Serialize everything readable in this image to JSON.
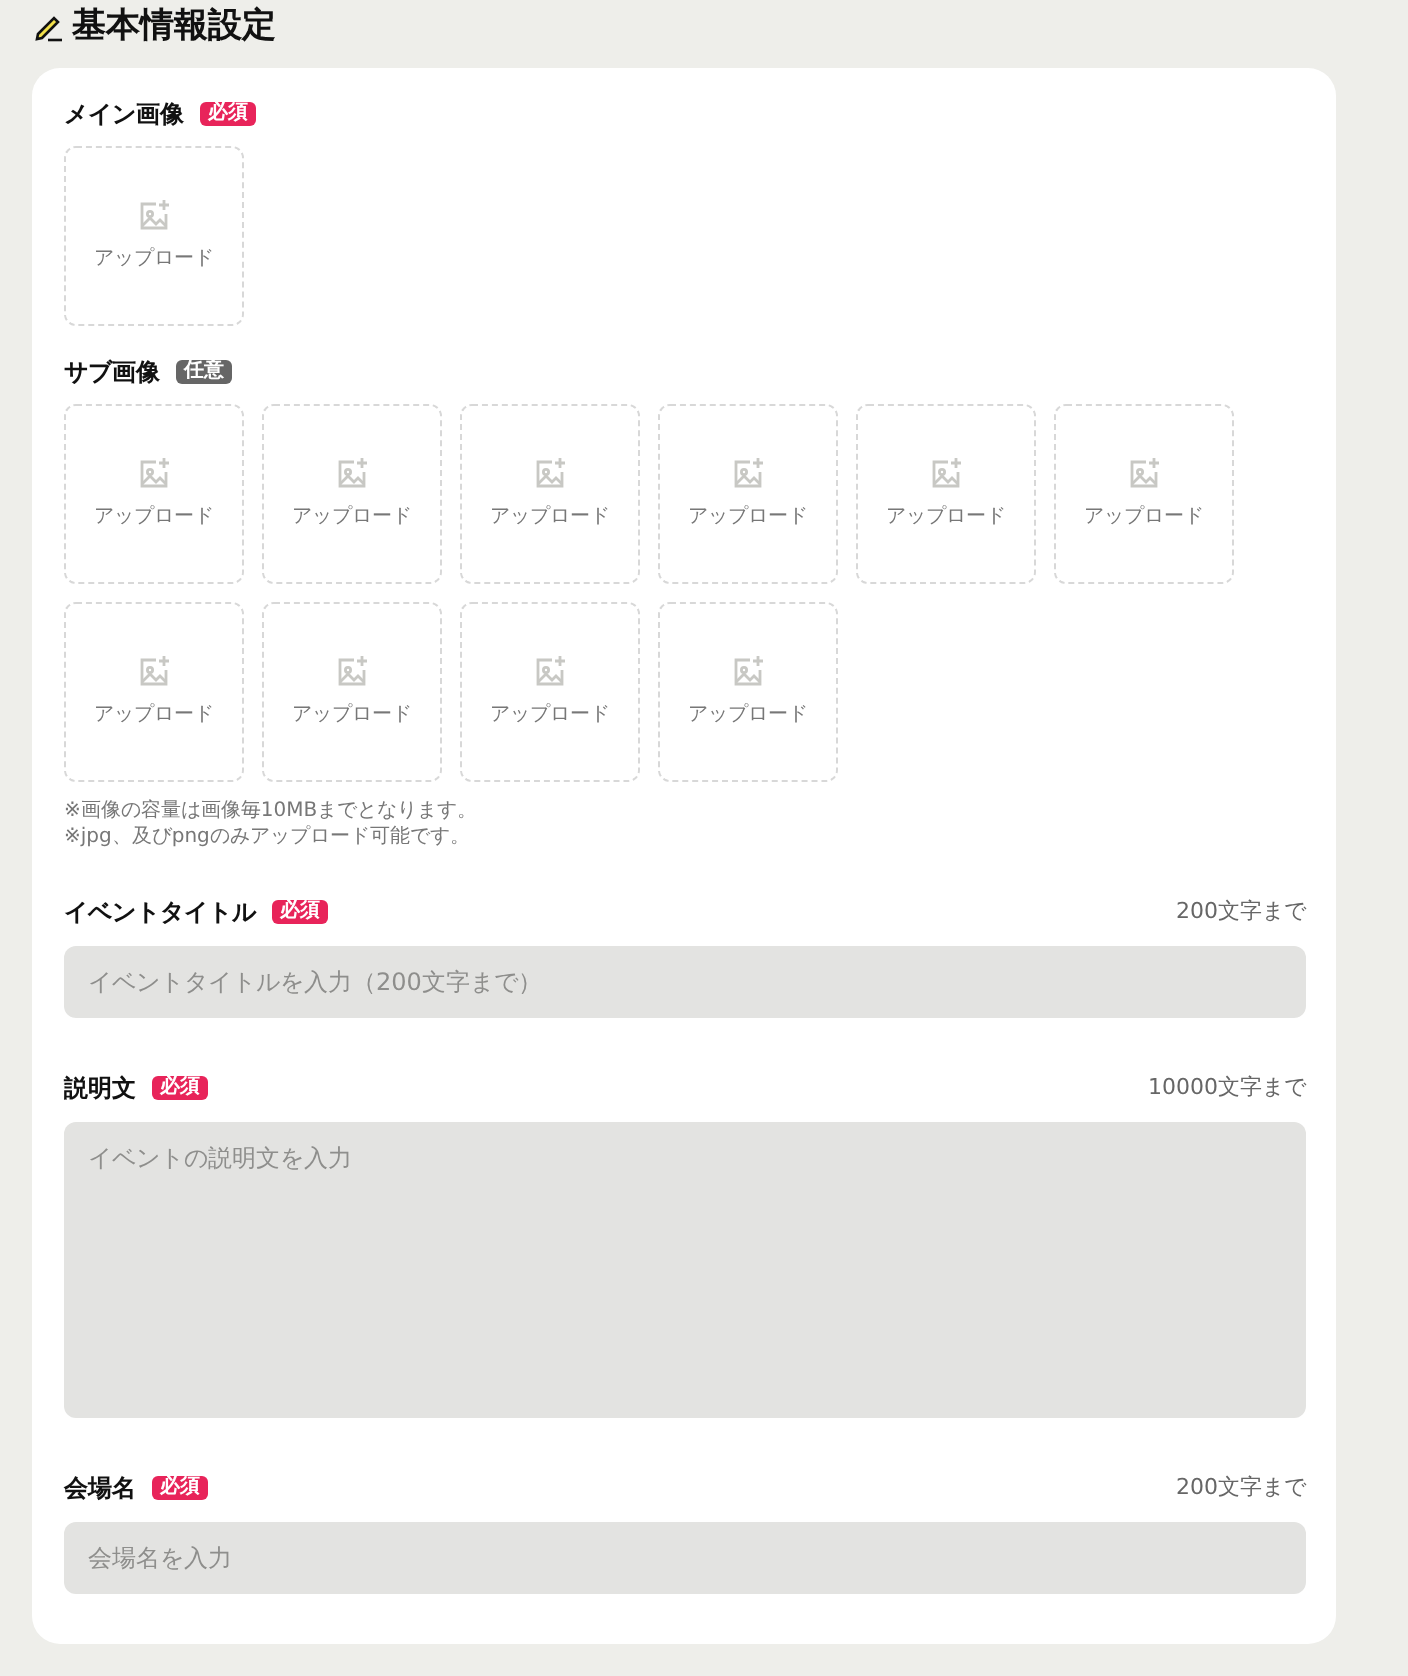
{
  "heading": "基本情報設定",
  "image_sections": [
    {
      "label": "メイン画像",
      "badge": {
        "text": "必須",
        "kind": "required"
      },
      "tiles": [
        {
          "label": "アップロード"
        }
      ]
    },
    {
      "label": "サブ画像",
      "badge": {
        "text": "任意",
        "kind": "optional"
      },
      "tiles": [
        {
          "label": "アップロード"
        },
        {
          "label": "アップロード"
        },
        {
          "label": "アップロード"
        },
        {
          "label": "アップロード"
        },
        {
          "label": "アップロード"
        },
        {
          "label": "アップロード"
        },
        {
          "label": "アップロード"
        },
        {
          "label": "アップロード"
        },
        {
          "label": "アップロード"
        },
        {
          "label": "アップロード"
        }
      ]
    }
  ],
  "notes": [
    "※画像の容量は画像毎10MBまでとなります。",
    "※jpg、及びpngのみアップロード可能です。"
  ],
  "fields": [
    {
      "kind": "input",
      "label": "イベントタイトル",
      "badge": {
        "text": "必須",
        "kind": "required"
      },
      "limit": "200文字まで",
      "placeholder": "イベントタイトルを入力（200文字まで）"
    },
    {
      "kind": "textarea",
      "label": "説明文",
      "badge": {
        "text": "必須",
        "kind": "required"
      },
      "limit": "10000文字まで",
      "placeholder": "イベントの説明文を入力"
    },
    {
      "kind": "input",
      "label": "会場名",
      "badge": {
        "text": "必須",
        "kind": "required"
      },
      "limit": "200文字まで",
      "placeholder": "会場名を入力"
    }
  ]
}
